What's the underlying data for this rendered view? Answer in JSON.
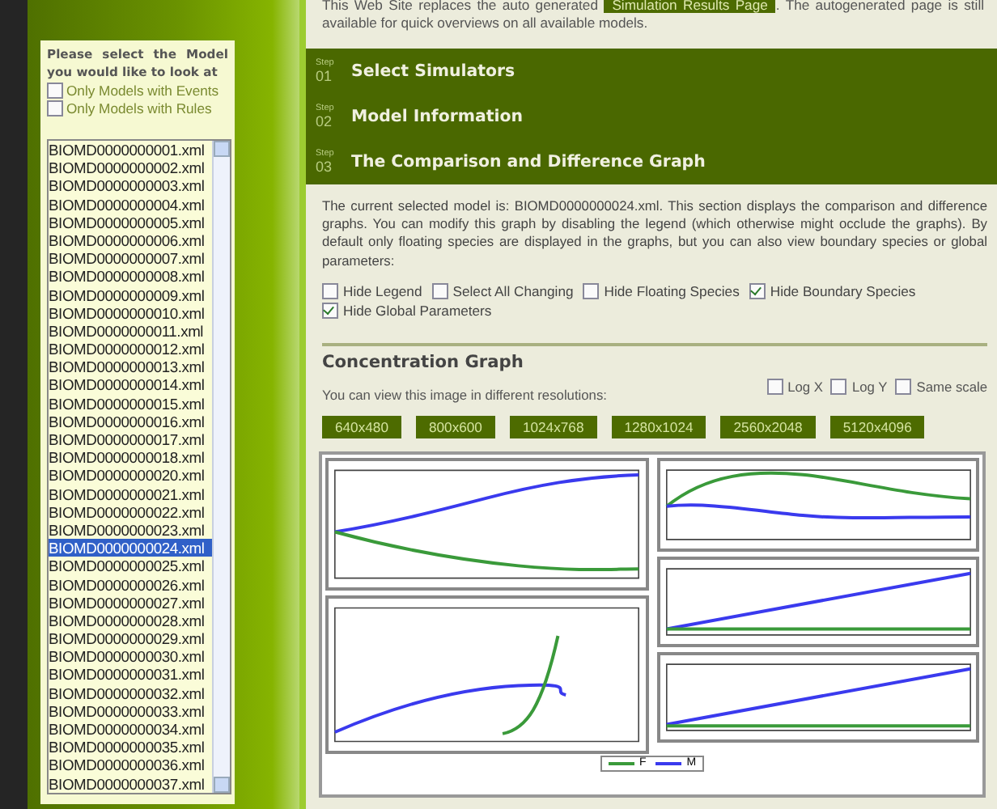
{
  "sidebar": {
    "prompt": "Please select the Model you would like to look at",
    "filters": [
      {
        "label": "Only Models with Events",
        "checked": false
      },
      {
        "label": "Only Models with Rules",
        "checked": false
      }
    ],
    "models": [
      {
        "name": "BIOMD0000000001.xml",
        "selected": false
      },
      {
        "name": "BIOMD0000000002.xml",
        "selected": false
      },
      {
        "name": "BIOMD0000000003.xml",
        "selected": false
      },
      {
        "name": "BIOMD0000000004.xml",
        "selected": false
      },
      {
        "name": "BIOMD0000000005.xml",
        "selected": false
      },
      {
        "name": "BIOMD0000000006.xml",
        "selected": false
      },
      {
        "name": "BIOMD0000000007.xml",
        "selected": false
      },
      {
        "name": "BIOMD0000000008.xml",
        "selected": false
      },
      {
        "name": "BIOMD0000000009.xml",
        "selected": false
      },
      {
        "name": "BIOMD0000000010.xml",
        "selected": false
      },
      {
        "name": "BIOMD0000000011.xml",
        "selected": false
      },
      {
        "name": "BIOMD0000000012.xml",
        "selected": false
      },
      {
        "name": "BIOMD0000000013.xml",
        "selected": false
      },
      {
        "name": "BIOMD0000000014.xml",
        "selected": false
      },
      {
        "name": "BIOMD0000000015.xml",
        "selected": false
      },
      {
        "name": "BIOMD0000000016.xml",
        "selected": false
      },
      {
        "name": "BIOMD0000000017.xml",
        "selected": false
      },
      {
        "name": "BIOMD0000000018.xml",
        "selected": false
      },
      {
        "name": "BIOMD0000000020.xml",
        "selected": false
      },
      {
        "name": "BIOMD0000000021.xml",
        "selected": false
      },
      {
        "name": "BIOMD0000000022.xml",
        "selected": false
      },
      {
        "name": "BIOMD0000000023.xml",
        "selected": false
      },
      {
        "name": "BIOMD0000000024.xml",
        "selected": true
      },
      {
        "name": "BIOMD0000000025.xml",
        "selected": false
      },
      {
        "name": "BIOMD0000000026.xml",
        "selected": false
      },
      {
        "name": "BIOMD0000000027.xml",
        "selected": false
      },
      {
        "name": "BIOMD0000000028.xml",
        "selected": false
      },
      {
        "name": "BIOMD0000000029.xml",
        "selected": false
      },
      {
        "name": "BIOMD0000000030.xml",
        "selected": false
      },
      {
        "name": "BIOMD0000000031.xml",
        "selected": false
      },
      {
        "name": "BIOMD0000000032.xml",
        "selected": false
      },
      {
        "name": "BIOMD0000000033.xml",
        "selected": false
      },
      {
        "name": "BIOMD0000000034.xml",
        "selected": false
      },
      {
        "name": "BIOMD0000000035.xml",
        "selected": false
      },
      {
        "name": "BIOMD0000000036.xml",
        "selected": false
      },
      {
        "name": "BIOMD0000000037.xml",
        "selected": false
      }
    ]
  },
  "intro": {
    "text_before": "This Web Site replaces the auto generated",
    "link": "Simulation Results Page",
    "text_after": ". The autogenerated page is still available for quick overviews on all available models."
  },
  "steps": [
    {
      "step_label": "Step",
      "number": "01",
      "title": "Select Simulators"
    },
    {
      "step_label": "Step",
      "number": "02",
      "title": "Model Information"
    },
    {
      "step_label": "Step",
      "number": "03",
      "title": "The Comparison and Difference Graph"
    }
  ],
  "description": "The current selected model is: BIOMD0000000024.xml. This section displays the comparison and difference graphs. You can modify this graph by disabling the legend (which otherwise might occlude the graphs). By default only floating species are displayed in the graphs, but you can also view boundary species or global parameters:",
  "options": [
    {
      "label": "Hide Legend",
      "checked": false
    },
    {
      "label": "Select All Changing",
      "checked": false
    },
    {
      "label": "Hide Floating Species",
      "checked": false
    },
    {
      "label": "Hide Boundary Species",
      "checked": true
    },
    {
      "label": "Hide Global Parameters",
      "checked": true
    }
  ],
  "concentration": {
    "title": "Concentration Graph",
    "scale_options": [
      {
        "label": "Log X",
        "checked": false
      },
      {
        "label": "Log Y",
        "checked": false
      },
      {
        "label": "Same scale",
        "checked": false
      }
    ],
    "resolutions_hint": "You can view this image in different resolutions:",
    "resolutions": [
      "640x480",
      "800x600",
      "1024x768",
      "1280x1024",
      "2560x2048",
      "5120x4096"
    ]
  },
  "legend": [
    {
      "label": "F",
      "color": "#3a9a3a"
    },
    {
      "label": "M",
      "color": "#3a3aee"
    }
  ]
}
